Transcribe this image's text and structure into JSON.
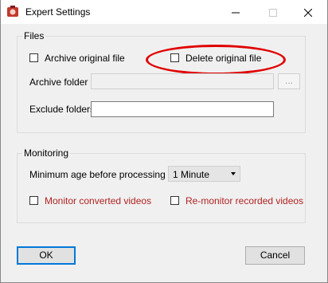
{
  "window": {
    "title": "Expert Settings",
    "controls": {
      "minimize": "—",
      "maximize": "☐",
      "close": "✕"
    }
  },
  "files": {
    "group_label": "Files",
    "archive_original_label": "Archive original file",
    "archive_original_checked": false,
    "delete_original_label": "Delete original file",
    "delete_original_checked": false,
    "archive_folder_label": "Archive folder",
    "archive_folder_value": "",
    "browse_label": "...",
    "exclude_folders_label": "Exclude folders",
    "exclude_folders_value": ""
  },
  "monitoring": {
    "group_label": "Monitoring",
    "min_age_label": "Minimum age before processing",
    "min_age_value": "1 Minute",
    "monitor_converted_label": "Monitor converted videos",
    "monitor_converted_checked": false,
    "remonitor_recorded_label": "Re-monitor recorded videos",
    "remonitor_recorded_checked": false
  },
  "buttons": {
    "ok": "OK",
    "cancel": "Cancel"
  },
  "colors": {
    "highlight": "#e00000",
    "warning_text": "#b22222",
    "focus": "#0078d7"
  },
  "icons": {
    "app": "app-logo-icon",
    "dropdown": "chevron-down-icon"
  }
}
